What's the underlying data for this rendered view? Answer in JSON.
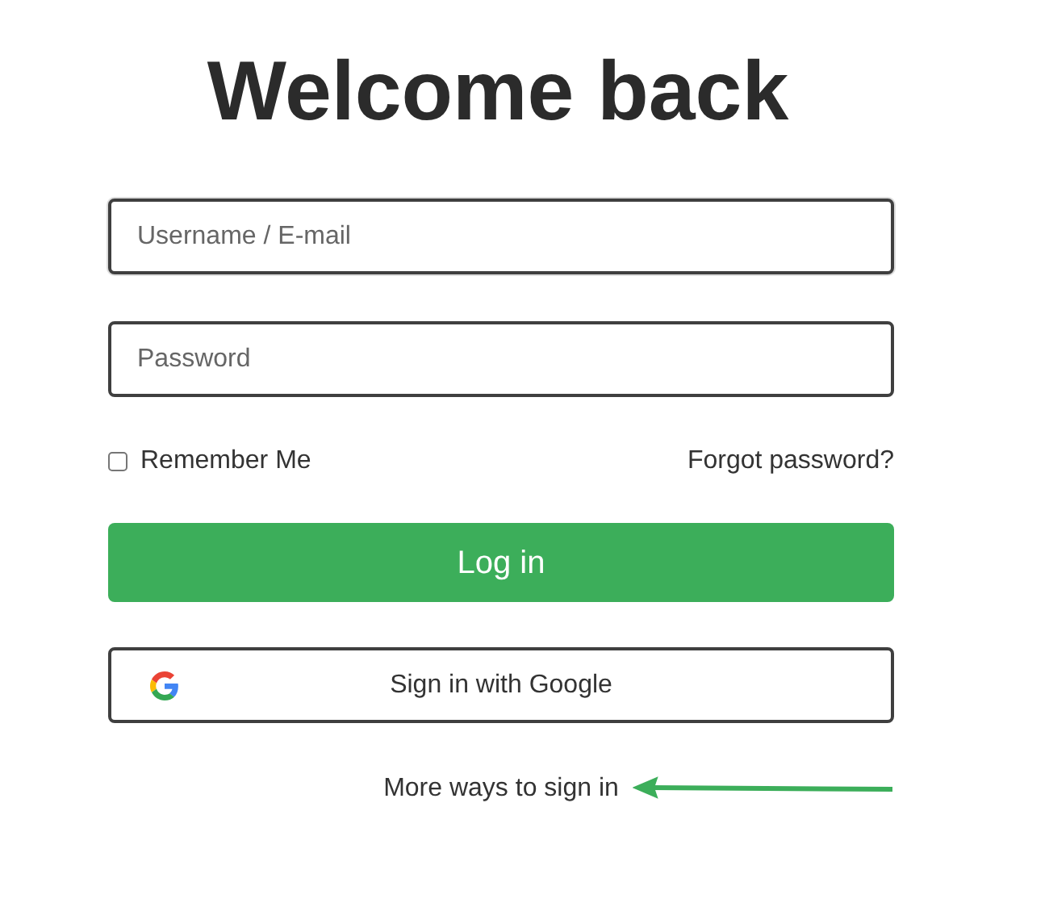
{
  "title": "Welcome back",
  "fields": [
    {
      "placeholder": "Username / E-mail",
      "focused": true
    },
    {
      "placeholder": "Password",
      "focused": false
    }
  ],
  "remember": {
    "label": "Remember Me",
    "checked": false
  },
  "forgot_link": "Forgot password?",
  "login_button": "Log in",
  "google_button": "Sign in with Google",
  "more_ways_link": "More ways to sign in"
}
